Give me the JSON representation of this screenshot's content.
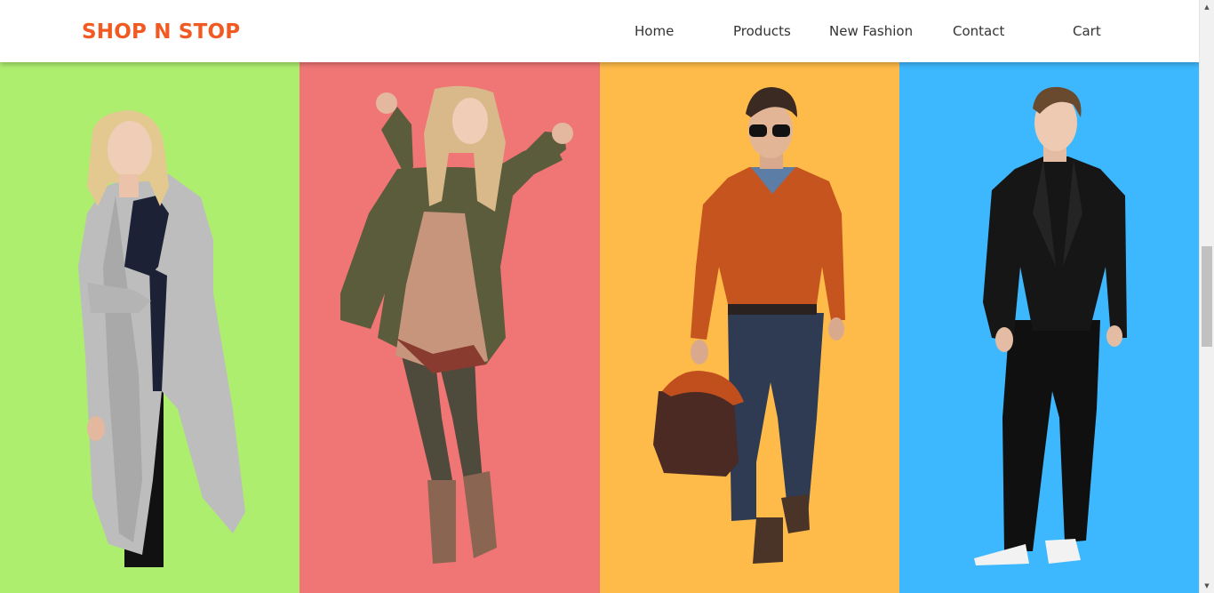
{
  "navbar": {
    "brand": "SHOP N STOP",
    "links": [
      {
        "label": "Home"
      },
      {
        "label": "Products"
      },
      {
        "label": "New Fashion"
      },
      {
        "label": "Contact"
      },
      {
        "label": "Cart"
      }
    ]
  },
  "colors": {
    "brand": "#f15a22",
    "nav_text": "#333333",
    "panel_1": "#aeee6e",
    "panel_2": "#f07575",
    "panel_3": "#ffbb49",
    "panel_4": "#3db8fe"
  },
  "panels": [
    {
      "image": "woman-grey-long-coat-photo"
    },
    {
      "image": "woman-olive-parka-photo"
    },
    {
      "image": "man-orange-sweater-photo"
    },
    {
      "image": "man-black-suit-photo"
    }
  ],
  "icons": {
    "scroll_up": "scroll-up-arrow-icon",
    "scroll_down": "scroll-down-arrow-icon"
  }
}
